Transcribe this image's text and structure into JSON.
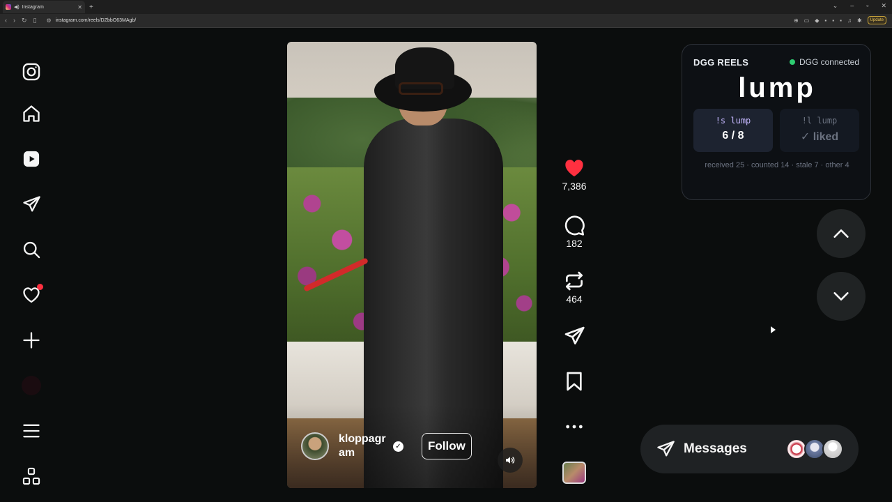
{
  "browser": {
    "tab_title": "Instagram",
    "new_tab": "+",
    "url": "instagram.com/reels/DZbbO63MAgb/",
    "update_label": "Update"
  },
  "sidebar": {
    "items": [
      {
        "name": "instagram-logo"
      },
      {
        "name": "home"
      },
      {
        "name": "reels"
      },
      {
        "name": "messages"
      },
      {
        "name": "search"
      },
      {
        "name": "notifications"
      },
      {
        "name": "create"
      },
      {
        "name": "profile"
      },
      {
        "name": "more"
      },
      {
        "name": "also-from-meta"
      }
    ]
  },
  "reel": {
    "owner": "kloppagram",
    "follow_label": "Follow",
    "likes": "7,386",
    "comments": "182",
    "reposts": "464"
  },
  "dgg": {
    "title": "DGG REELS",
    "status": "DGG connected",
    "status_color": "#2ecc71",
    "word": "lump",
    "left_cmd": "!s lump",
    "left_value": "6 / 8",
    "right_cmd": "!l lump",
    "right_value": "✓ liked",
    "stats": "received 25 · counted 14 · stale 7 · other 4"
  },
  "messages": {
    "label": "Messages"
  },
  "colors": {
    "like_red": "#ff3040",
    "background": "#0b0d0d"
  }
}
